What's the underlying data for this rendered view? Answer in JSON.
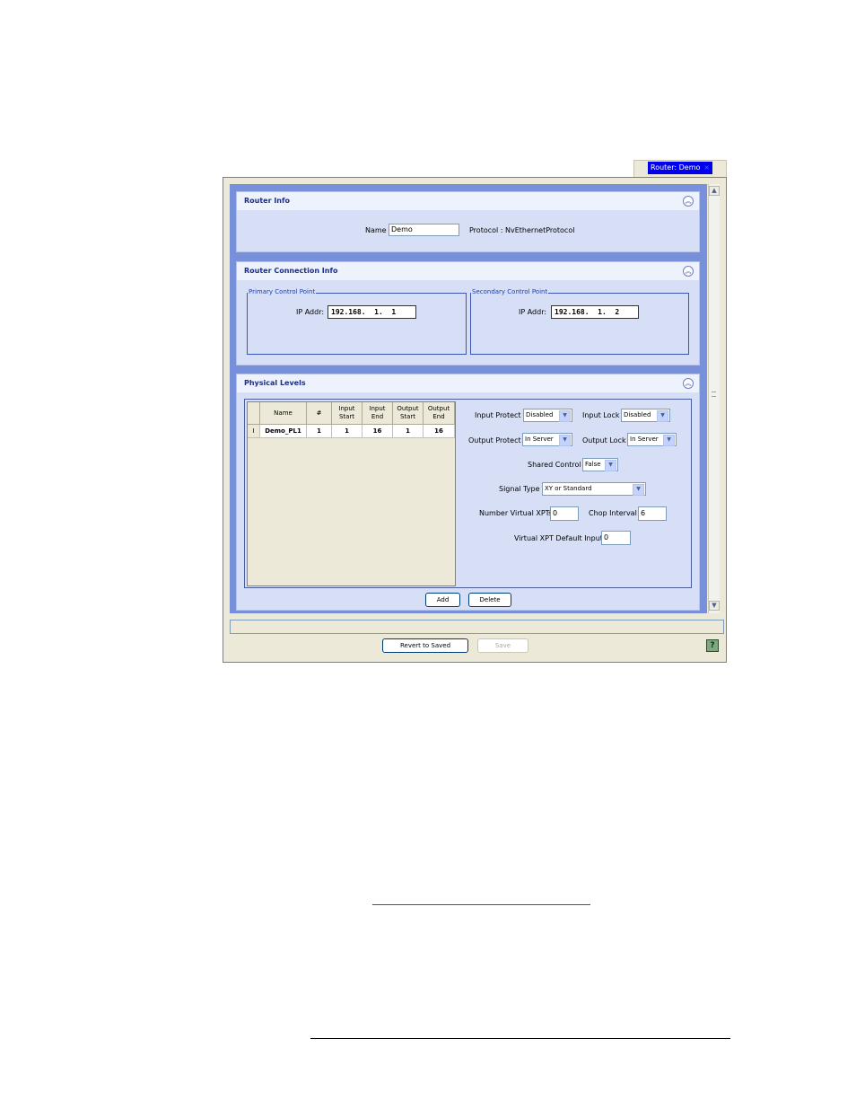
{
  "tab": {
    "label": "Router: Demo",
    "close": "×"
  },
  "router_info": {
    "title": "Router Info",
    "name_label": "Name",
    "name_value": "Demo",
    "protocol_label": "Protocol : NvEthernetProtocol"
  },
  "connection": {
    "title": "Router Connection Info",
    "primary": {
      "title": "Primary Control Point",
      "ip_label": "IP Addr:",
      "ip_value": "192.168.  1.  1"
    },
    "secondary": {
      "title": "Secondary Control Point",
      "ip_label": "IP Addr:",
      "ip_value": "192.168.  1.  2"
    }
  },
  "physical_levels": {
    "title": "Physical Levels",
    "columns": [
      "Name",
      "#",
      "Input Start",
      "Input End",
      "Output Start",
      "Output End"
    ],
    "rows": [
      {
        "marker": "I",
        "name": "Demo_PL1",
        "num": "1",
        "input_start": "1",
        "input_end": "16",
        "output_start": "1",
        "output_end": "16"
      }
    ],
    "input_protect": {
      "label": "Input Protect",
      "value": "Disabled"
    },
    "input_lock": {
      "label": "Input Lock",
      "value": "Disabled"
    },
    "output_protect": {
      "label": "Output Protect",
      "value": "In Server"
    },
    "output_lock": {
      "label": "Output Lock",
      "value": "In Server"
    },
    "shared_control": {
      "label": "Shared Control",
      "value": "False"
    },
    "signal_type": {
      "label": "Signal Type",
      "value": "XY or Standard"
    },
    "num_virtual_xpts": {
      "label": "Number Virtual XPTs",
      "value": "0"
    },
    "chop_interval": {
      "label": "Chop Interval",
      "value": "6"
    },
    "virtual_xpt_default_input": {
      "label": "Virtual XPT Default Input",
      "value": "0"
    },
    "add_label": "Add",
    "delete_label": "Delete"
  },
  "footer": {
    "revert_label": "Revert to Saved",
    "save_label": "Save"
  },
  "icons": {
    "collapse": "chevron-double-up-icon",
    "dropdown": "chevron-down-icon",
    "help": "help-icon"
  }
}
